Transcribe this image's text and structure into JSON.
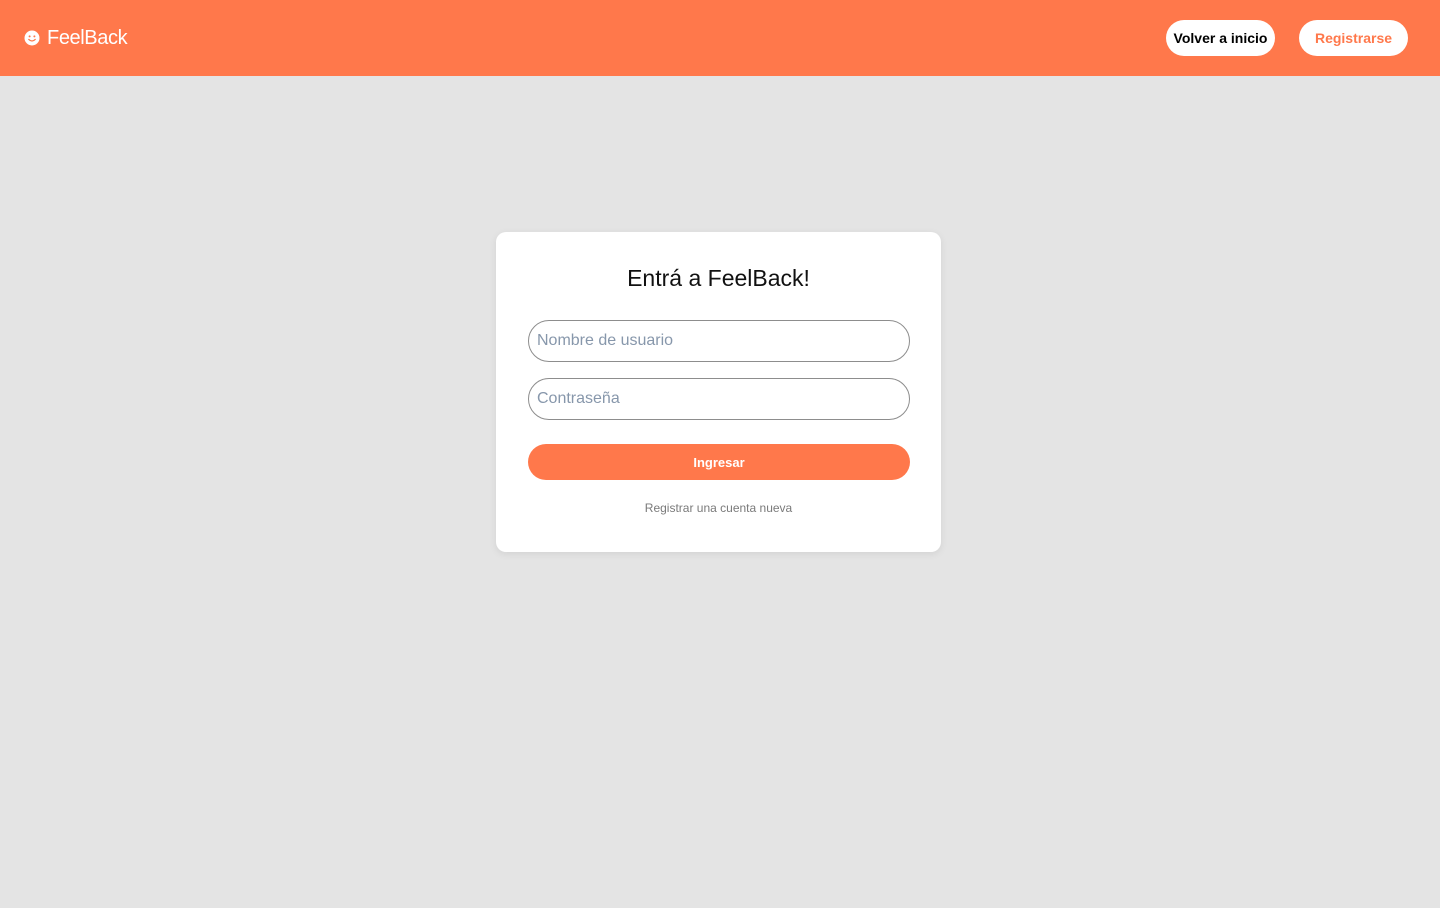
{
  "header": {
    "brand_name": "FeelBack",
    "brand_icon": "smiley-icon",
    "home_button_label": "Volver a inicio",
    "register_button_label": "Registrarse",
    "accent_color": "#ff784b"
  },
  "login": {
    "title": "Entrá a FeelBack!",
    "username_placeholder": "Nombre de usuario",
    "username_value": "",
    "password_placeholder": "Contraseña",
    "password_value": "",
    "submit_label": "Ingresar",
    "register_link_label": "Registrar una cuenta nueva"
  }
}
